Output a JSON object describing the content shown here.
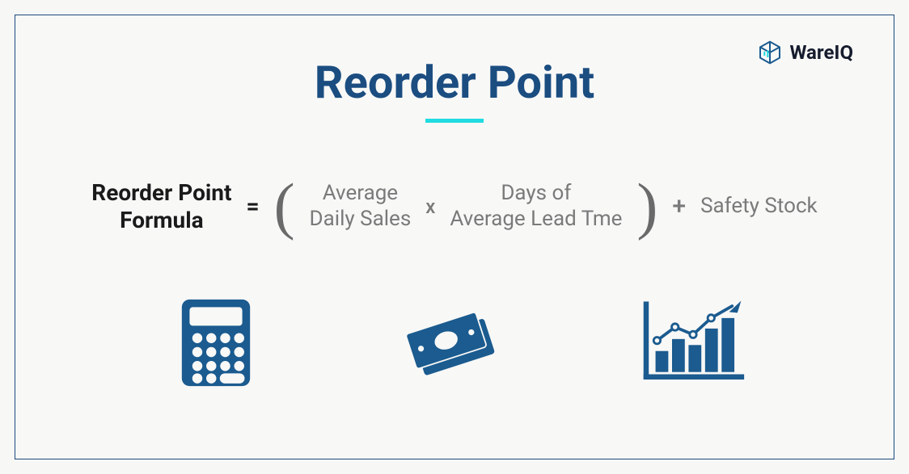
{
  "brand": {
    "name": "WareIQ"
  },
  "title": "Reorder Point",
  "formula": {
    "label_line1": "Reorder Point",
    "label_line2": "Formula",
    "equals": "=",
    "term1_line1": "Average",
    "term1_line2": "Daily Sales",
    "multiply": "x",
    "term2_line1": "Days of",
    "term2_line2": "Average Lead Tme",
    "plus": "+",
    "term3": "Safety Stock"
  },
  "colors": {
    "accent": "#1b4d80",
    "underline": "#20dbe0",
    "icon": "#1b5b8f"
  }
}
